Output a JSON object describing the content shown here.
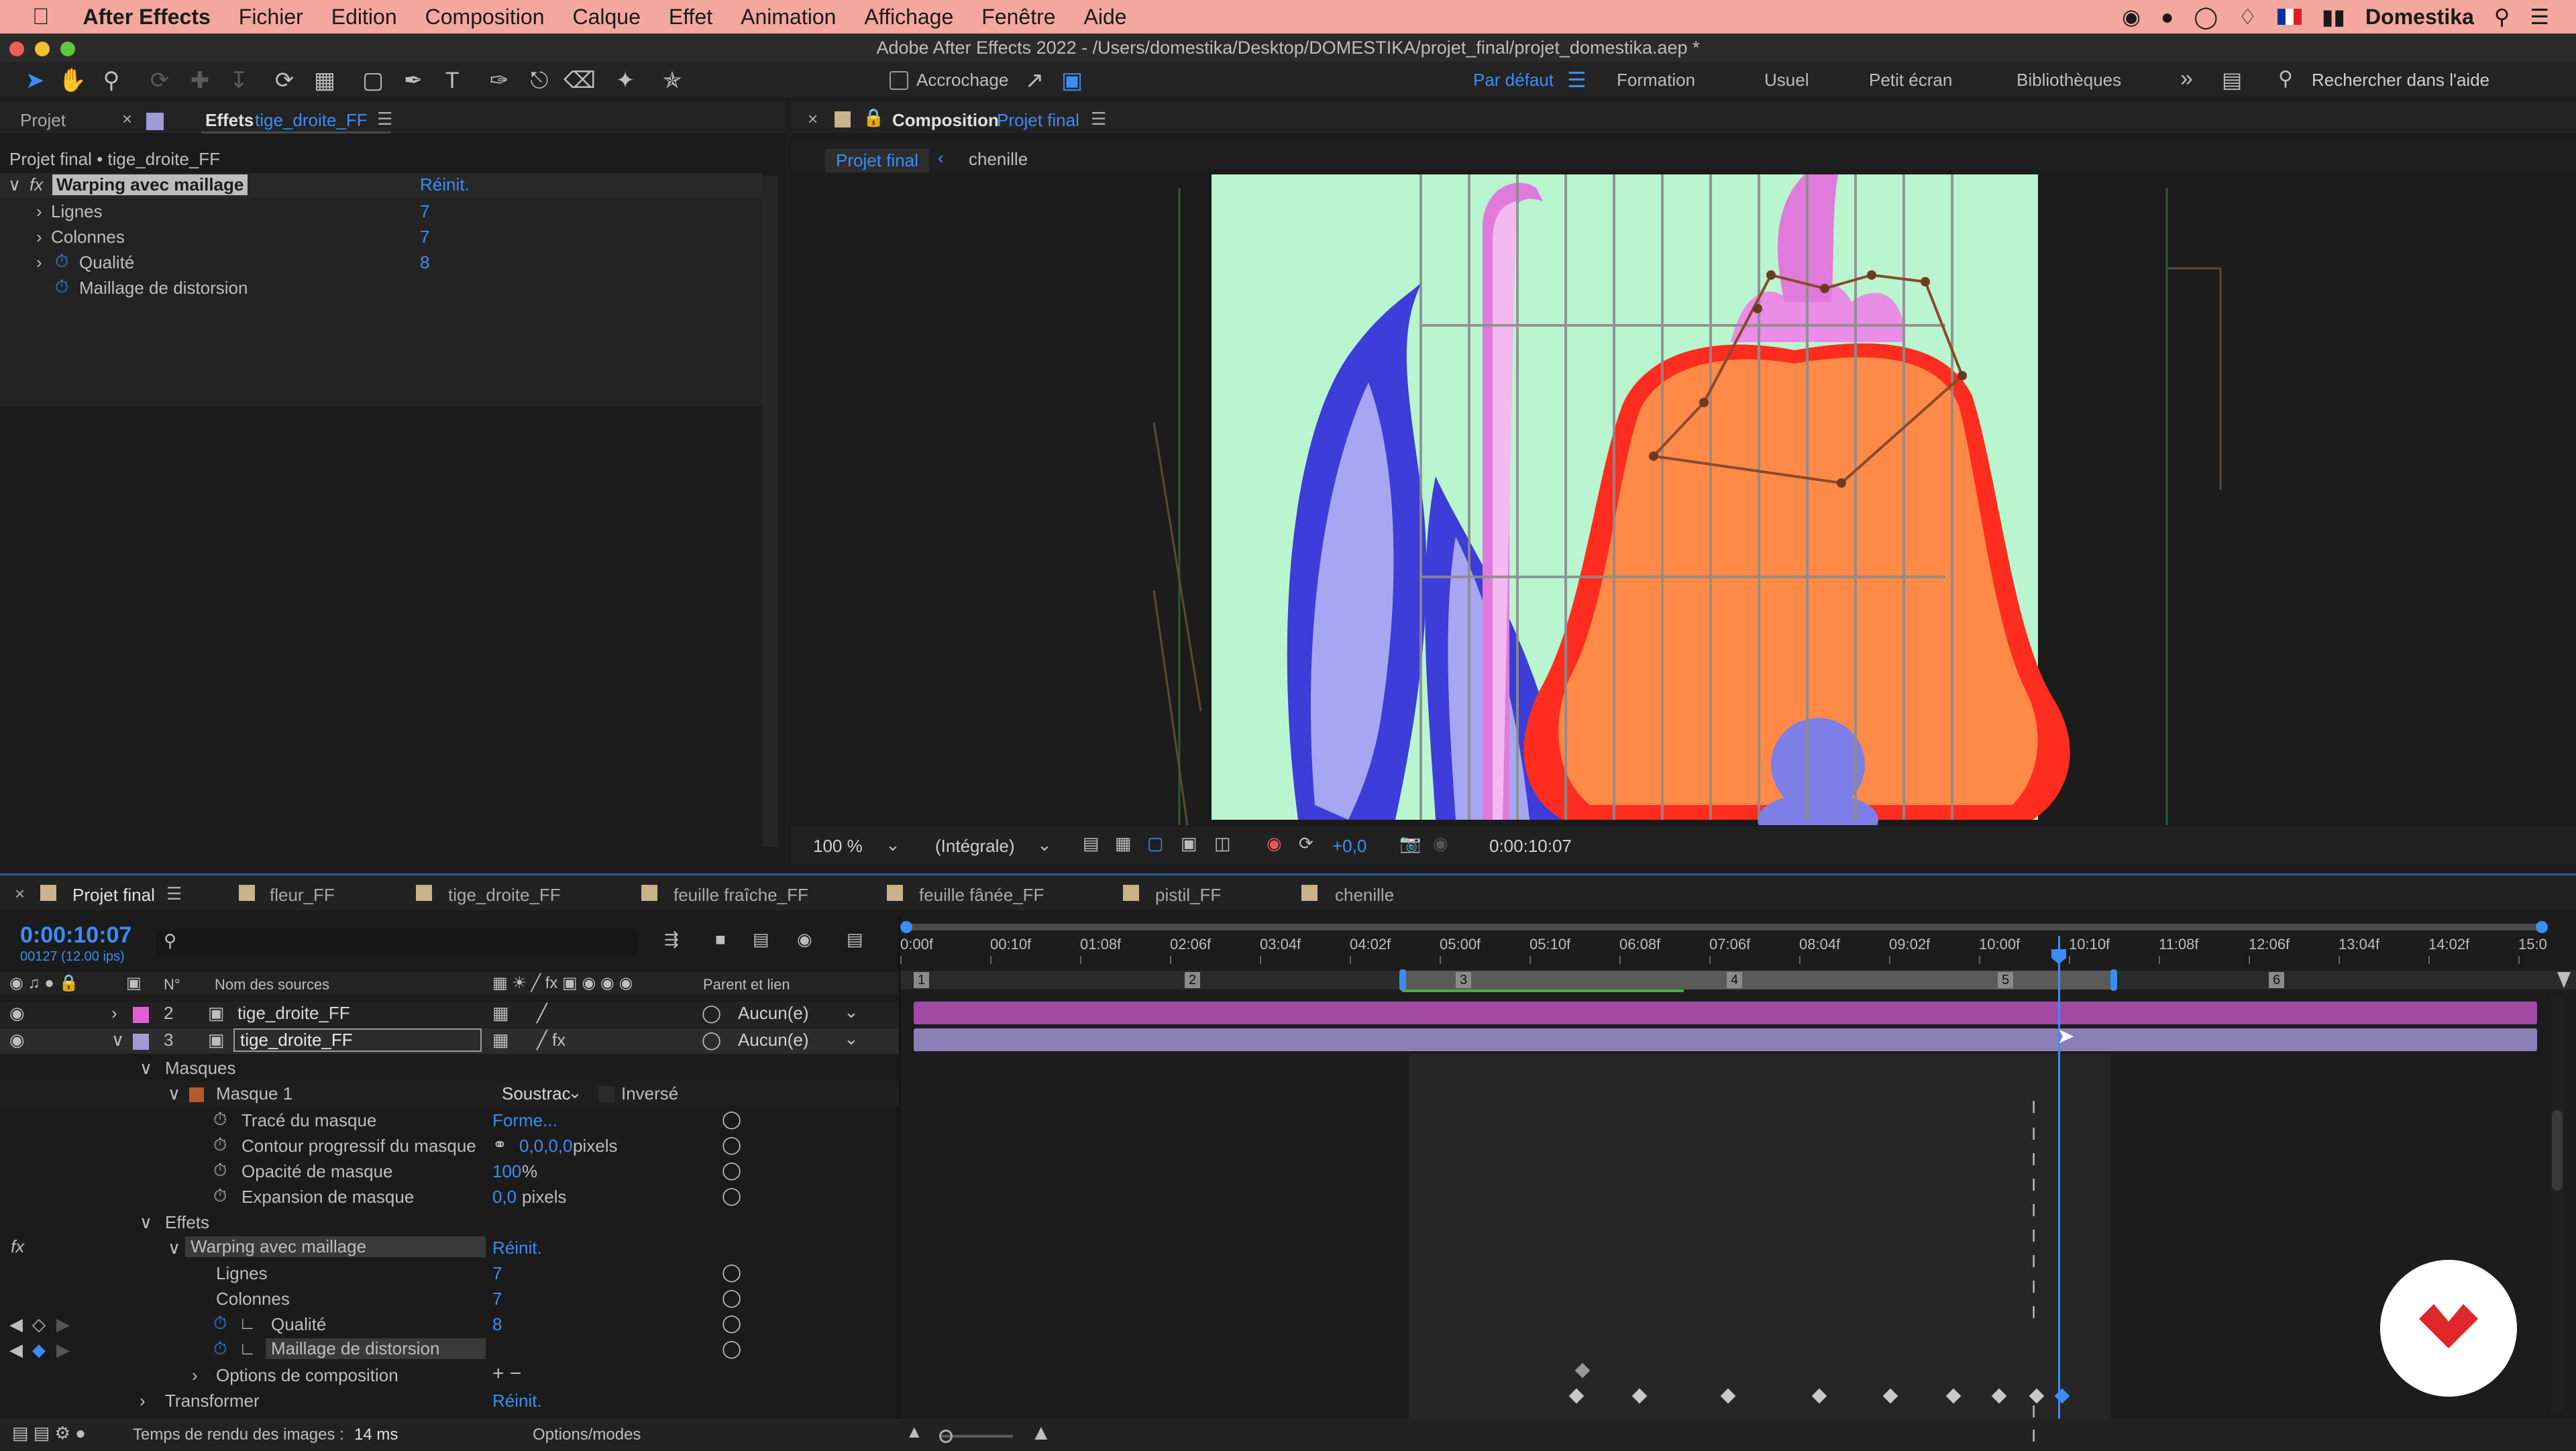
{
  "menubar": {
    "app": "After Effects",
    "items": [
      "Fichier",
      "Edition",
      "Composition",
      "Calque",
      "Effet",
      "Animation",
      "Affichage",
      "Fenêtre",
      "Aide"
    ],
    "brand": "Domestika"
  },
  "window": {
    "title": "Adobe After Effects 2022 - /Users/domestika/Desktop/DOMESTIKA/projet_final/projet_domestika.aep *"
  },
  "toolbar": {
    "snapping": "Accrochage",
    "workspaces": [
      "Par défaut",
      "Formation",
      "Usuel",
      "Petit écran",
      "Bibliothèques"
    ],
    "help_search": "Rechercher dans l'aide"
  },
  "effects_panel": {
    "tab_project": "Projet",
    "tab_effects": "Effets",
    "tab_effects_layer": "tige_droite_FF",
    "breadcrumb": "Projet final • tige_droite_FF",
    "effect_name": "Warping avec maillage",
    "reset": "Réinit.",
    "props": [
      {
        "label": "Lignes",
        "value": "7"
      },
      {
        "label": "Colonnes",
        "value": "7"
      },
      {
        "label": "Qualité",
        "value": "8"
      },
      {
        "label": "Maillage de distorsion",
        "value": ""
      }
    ]
  },
  "comp_panel": {
    "tab_label": "Composition",
    "tab_comp": "Projet final",
    "flow": [
      "Projet final",
      "chenille"
    ],
    "zoom": "100 %",
    "resolution": "(Intégrale)",
    "exposure": "+0,0",
    "timecode": "0:00:10:07"
  },
  "timeline": {
    "tabs": [
      "Projet final",
      "fleur_FF",
      "tige_droite_FF",
      "feuille fraîche_FF",
      "feuille fânée_FF",
      "pistil_FF",
      "chenille"
    ],
    "current_time": "0:00:10:07",
    "frame_info": "00127 (12.00 ips)",
    "col_num": "N°",
    "col_source": "Nom des sources",
    "col_parent": "Parent et lien",
    "ruler": [
      "0:00f",
      "00:10f",
      "01:08f",
      "02:06f",
      "03:04f",
      "04:02f",
      "05:00f",
      "05:10f",
      "06:08f",
      "07:06f",
      "08:04f",
      "09:02f",
      "10:00f",
      "10:10f",
      "11:08f",
      "12:06f",
      "13:04f",
      "14:02f",
      "15:0"
    ],
    "markers": [
      "1",
      "2",
      "3",
      "4",
      "5",
      "6"
    ],
    "layers": [
      {
        "num": "2",
        "name": "tige_droite_FF",
        "parent": "Aucun(e)",
        "color": "#e45fd6"
      },
      {
        "num": "3",
        "name": "tige_droite_FF",
        "parent": "Aucun(e)",
        "color": "#a29ad6"
      }
    ],
    "props": {
      "masks": "Masques",
      "mask1": "Masque 1",
      "mask_mode": "Soustrac",
      "inverted": "Inversé",
      "mask_path": {
        "label": "Tracé du masque",
        "value": "Forme..."
      },
      "mask_feather": {
        "label": "Contour progressif du masque",
        "value": "0,0,0,0",
        "unit": "pixels"
      },
      "mask_opacity": {
        "label": "Opacité de masque",
        "value": "100",
        "unit": "%"
      },
      "mask_expansion": {
        "label": "Expansion de masque",
        "value": "0,0",
        "unit": "pixels"
      },
      "effects": "Effets",
      "effect_name": "Warping avec maillage",
      "reset": "Réinit.",
      "rows": {
        "label": "Lignes",
        "value": "7"
      },
      "cols": {
        "label": "Colonnes",
        "value": "7"
      },
      "quality": {
        "label": "Qualité",
        "value": "8"
      },
      "distortion": "Maillage de distorsion",
      "comp_options": "Options de composition",
      "transform": "Transformer",
      "transform_reset": "Réinit."
    },
    "status": {
      "render_time_label": "Temps de rendu des images :",
      "render_time_value": "14 ms",
      "modes": "Options/modes"
    }
  },
  "colors": {
    "accent": "#3a8df5",
    "menubar": "#f4a79e",
    "comp_bg": "#b9f5cf",
    "flower": "#ff8a47",
    "layer_pink": "#a24aa3",
    "layer_lilac": "#8a7fb6"
  }
}
